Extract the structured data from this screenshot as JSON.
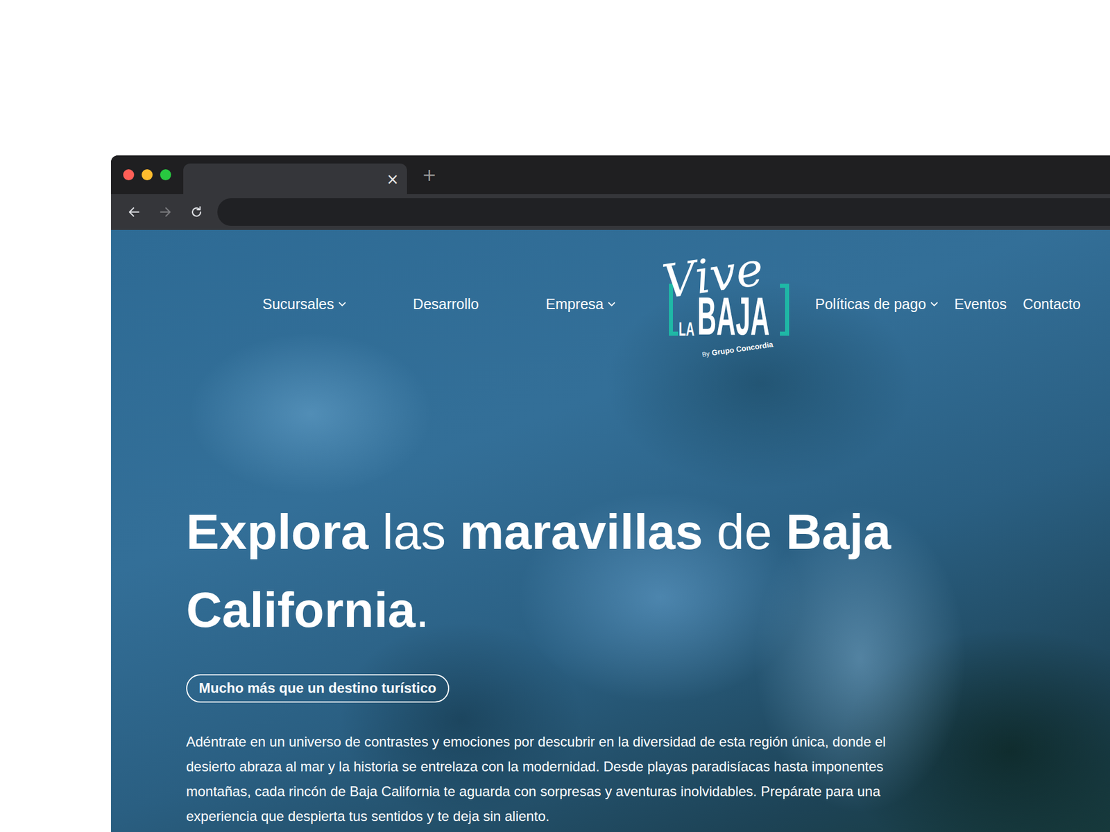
{
  "window_controls": [
    {
      "color": "#ff5f57"
    },
    {
      "color": "#febc2e"
    },
    {
      "color": "#28c840"
    }
  ],
  "tab": {
    "close": "×"
  },
  "new_tab": "+",
  "toolbar": {
    "back": {
      "disabled": false
    },
    "forward": {
      "disabled": true
    },
    "reload": {
      "disabled": false
    }
  },
  "nav": {
    "left": [
      {
        "label": "Sucursales",
        "dropdown": true
      },
      {
        "label": "Desarrollo",
        "dropdown": false
      },
      {
        "label": "Empresa",
        "dropdown": true
      }
    ],
    "right": [
      {
        "label": "Políticas de pago",
        "dropdown": true
      },
      {
        "label": "Eventos",
        "dropdown": false
      },
      {
        "label": "Contacto",
        "dropdown": false
      }
    ]
  },
  "logo": {
    "script": "Vive",
    "la": "LA",
    "baja": "BAJA",
    "by": "By",
    "company": "Grupo Concordia"
  },
  "hero": {
    "heading": [
      {
        "text": "Explora ",
        "bold": true
      },
      {
        "text": "las ",
        "bold": false
      },
      {
        "text": "maravillas ",
        "bold": true
      },
      {
        "text": "de ",
        "bold": false
      },
      {
        "text": "Baja ",
        "bold": true
      },
      {
        "text": "California",
        "bold": true
      },
      {
        "text": ".",
        "bold": false
      }
    ],
    "tagline": "Mucho más que un destino turístico",
    "body": "Adéntrate en un universo de contrastes y emociones por descubrir en la diversidad de esta región única, donde el desierto abraza al mar y la historia se entrelaza con la modernidad. Desde playas paradisíacas hasta imponentes montañas, cada rincón de Baja California te aguarda con sorpresas y aventuras inolvidables. Prepárate para una experiencia que despierta tus sentidos y te deja sin aliento."
  }
}
